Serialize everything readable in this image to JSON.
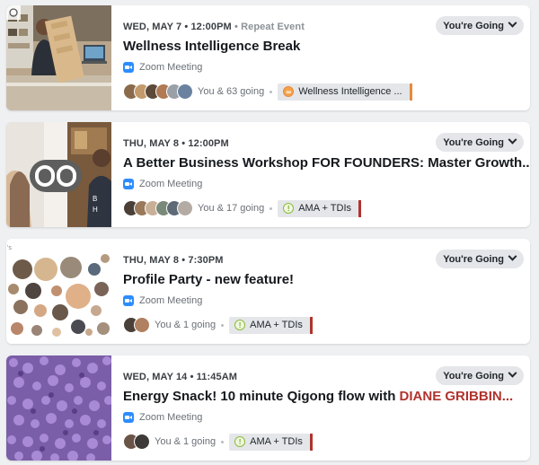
{
  "colors": {
    "accent_red": "#b0332e",
    "zoom_blue": "#2d8cff",
    "tag_bar_orange": "#e8893a",
    "tag_bar_red": "#b0332e"
  },
  "events": [
    {
      "date": "WED, MAY 7",
      "time": "12:00PM",
      "repeat": "Repeat Event",
      "title": "Wellness Intelligence Break",
      "title_highlight": "",
      "location": "Zoom Meeting",
      "going": "You & 63 going",
      "tag": "Wellness Intelligence ...",
      "tag_icon": "link-icon",
      "rsvp": "You're Going"
    },
    {
      "date": "THU, MAY 8",
      "time": "12:00PM",
      "repeat": "",
      "title": "A Better Business Workshop FOR FOUNDERS: Master Growth...",
      "title_highlight": "",
      "location": "Zoom Meeting",
      "going": "You & 17 going",
      "tag": "AMA + TDIs",
      "tag_icon": "exclamation-icon",
      "rsvp": "You're Going"
    },
    {
      "date": "THU, MAY 8",
      "time": "7:30PM",
      "repeat": "",
      "title": "Profile Party - new feature!",
      "title_highlight": "",
      "location": "Zoom Meeting",
      "going": "You & 1 going",
      "tag": "AMA + TDIs",
      "tag_icon": "exclamation-icon",
      "rsvp": "You're Going"
    },
    {
      "date": "WED, MAY 14",
      "time": "11:45AM",
      "repeat": "",
      "title": "Energy Snack! 10 minute Qigong flow with ",
      "title_highlight": "DIANE GRIBBIN...",
      "location": "Zoom Meeting",
      "going": "You & 1 going",
      "tag": "AMA + TDIs",
      "tag_icon": "exclamation-icon",
      "rsvp": "You're Going"
    }
  ]
}
